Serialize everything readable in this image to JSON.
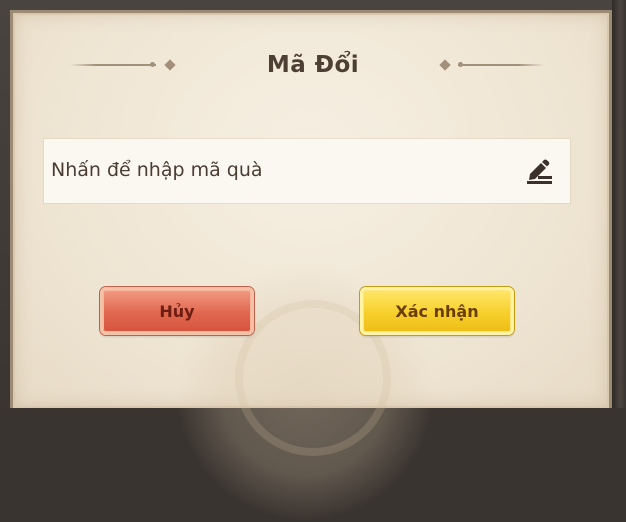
{
  "dialog": {
    "title": "Mã Đổi",
    "input": {
      "placeholder": "Nhấn để nhập mã quà"
    },
    "buttons": {
      "cancel_label": "Hủy",
      "confirm_label": "Xác nhận"
    }
  },
  "icons": {
    "edit": "edit-icon",
    "ornament": "diamond-ornament-icon"
  },
  "colors": {
    "panel_bg": "#f2e9d9",
    "title_text": "#4d3f33",
    "cancel_button": "#e1674f",
    "confirm_button": "#f7cf2b"
  }
}
